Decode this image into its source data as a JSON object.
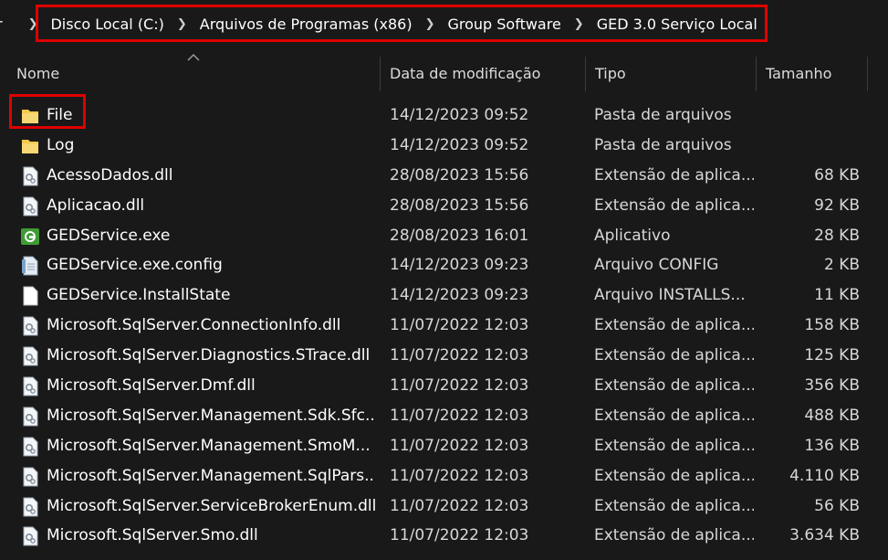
{
  "breadcrumb": {
    "cut_prefix": "r",
    "items": [
      "Disco Local (C:)",
      "Arquivos de Programas (x86)",
      "Group Software",
      "GED 3.0 Serviço Local"
    ]
  },
  "columns": {
    "name": "Nome",
    "date": "Data de modificação",
    "type": "Tipo",
    "size": "Tamanho"
  },
  "colors": {
    "highlight": "#e00000",
    "folder": "#f2c94c",
    "exe": "#3f9c35"
  },
  "files": [
    {
      "name": "File",
      "date": "14/12/2023 09:52",
      "type": "Pasta de arquivos",
      "size": "",
      "icon": "folder-icon"
    },
    {
      "name": "Log",
      "date": "14/12/2023 09:52",
      "type": "Pasta de arquivos",
      "size": "",
      "icon": "folder-icon"
    },
    {
      "name": "AcessoDados.dll",
      "date": "28/08/2023 15:56",
      "type": "Extensão de aplica...",
      "size": "68 KB",
      "icon": "dll-icon"
    },
    {
      "name": "Aplicacao.dll",
      "date": "28/08/2023 15:56",
      "type": "Extensão de aplica...",
      "size": "92 KB",
      "icon": "dll-icon"
    },
    {
      "name": "GEDService.exe",
      "date": "28/08/2023 16:01",
      "type": "Aplicativo",
      "size": "28 KB",
      "icon": "exe-icon"
    },
    {
      "name": "GEDService.exe.config",
      "date": "14/12/2023 09:23",
      "type": "Arquivo CONFIG",
      "size": "2 KB",
      "icon": "config-icon"
    },
    {
      "name": "GEDService.InstallState",
      "date": "14/12/2023 09:23",
      "type": "Arquivo INSTALLS...",
      "size": "11 KB",
      "icon": "file-icon"
    },
    {
      "name": "Microsoft.SqlServer.ConnectionInfo.dll",
      "date": "11/07/2022 12:03",
      "type": "Extensão de aplica...",
      "size": "158 KB",
      "icon": "dll-icon"
    },
    {
      "name": "Microsoft.SqlServer.Diagnostics.STrace.dll",
      "date": "11/07/2022 12:03",
      "type": "Extensão de aplica...",
      "size": "125 KB",
      "icon": "dll-icon"
    },
    {
      "name": "Microsoft.SqlServer.Dmf.dll",
      "date": "11/07/2022 12:03",
      "type": "Extensão de aplica...",
      "size": "356 KB",
      "icon": "dll-icon"
    },
    {
      "name": "Microsoft.SqlServer.Management.Sdk.Sfc...",
      "date": "11/07/2022 12:03",
      "type": "Extensão de aplica...",
      "size": "488 KB",
      "icon": "dll-icon"
    },
    {
      "name": "Microsoft.SqlServer.Management.SmoM...",
      "date": "11/07/2022 12:03",
      "type": "Extensão de aplica...",
      "size": "136 KB",
      "icon": "dll-icon"
    },
    {
      "name": "Microsoft.SqlServer.Management.SqlPars...",
      "date": "11/07/2022 12:03",
      "type": "Extensão de aplica...",
      "size": "4.110 KB",
      "icon": "dll-icon"
    },
    {
      "name": "Microsoft.SqlServer.ServiceBrokerEnum.dll",
      "date": "11/07/2022 12:03",
      "type": "Extensão de aplica...",
      "size": "56 KB",
      "icon": "dll-icon"
    },
    {
      "name": "Microsoft.SqlServer.Smo.dll",
      "date": "11/07/2022 12:03",
      "type": "Extensão de aplica...",
      "size": "3.634 KB",
      "icon": "dll-icon"
    }
  ]
}
